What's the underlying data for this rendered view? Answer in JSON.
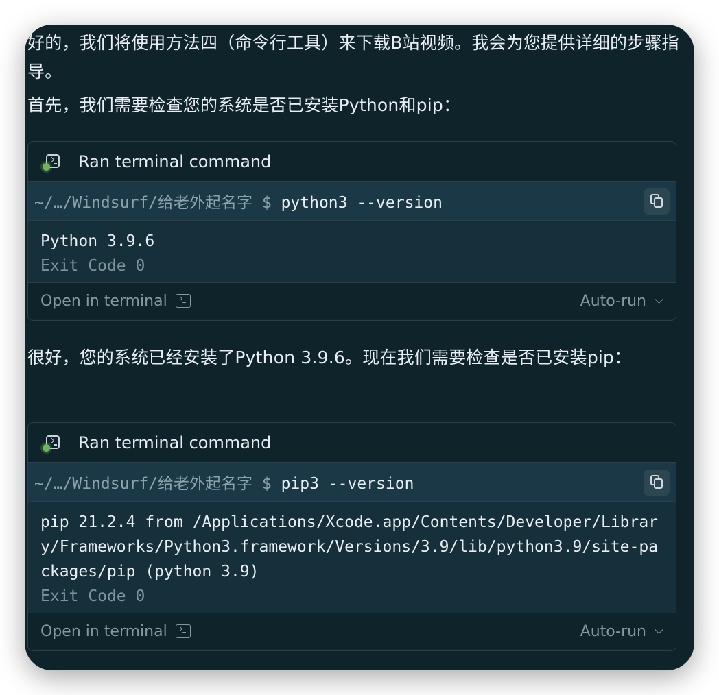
{
  "messages": {
    "intro": "好的，我们将使用方法四（命令行工具）来下载B站视频。我会为您提供详细的步骤指导。",
    "check_python": "首先，我们需要检查您的系统是否已安装Python和pip：",
    "python_ok": "很好，您的系统已经安装了Python 3.9.6。现在我们需要检查是否已安装pip："
  },
  "cards": [
    {
      "title": "Ran terminal command",
      "prompt": "~/…/Windsurf/给老外起名字 $ ",
      "command": "python3 --version",
      "output": "Python 3.9.6",
      "exit_code": "Exit Code 0",
      "open_terminal": "Open in terminal",
      "auto_run": "Auto-run"
    },
    {
      "title": "Ran terminal command",
      "prompt": "~/…/Windsurf/给老外起名字 $ ",
      "command": "pip3 --version",
      "output": "pip 21.2.4 from /Applications/Xcode.app/Contents/Developer/Library/Frameworks/Python3.framework/Versions/3.9/lib/python3.9/site-packages/pip (python 3.9)",
      "exit_code": "Exit Code 0",
      "open_terminal": "Open in terminal",
      "auto_run": "Auto-run"
    }
  ],
  "icons": {
    "terminal": "terminal-icon",
    "copy": "copy-icon",
    "chevron": "chevron-down-icon",
    "status": "status-dot"
  },
  "colors": {
    "background": "#0f232b",
    "command_row": "#1a3846",
    "status_green": "#6fb35a",
    "muted_text": "#8597a0"
  }
}
